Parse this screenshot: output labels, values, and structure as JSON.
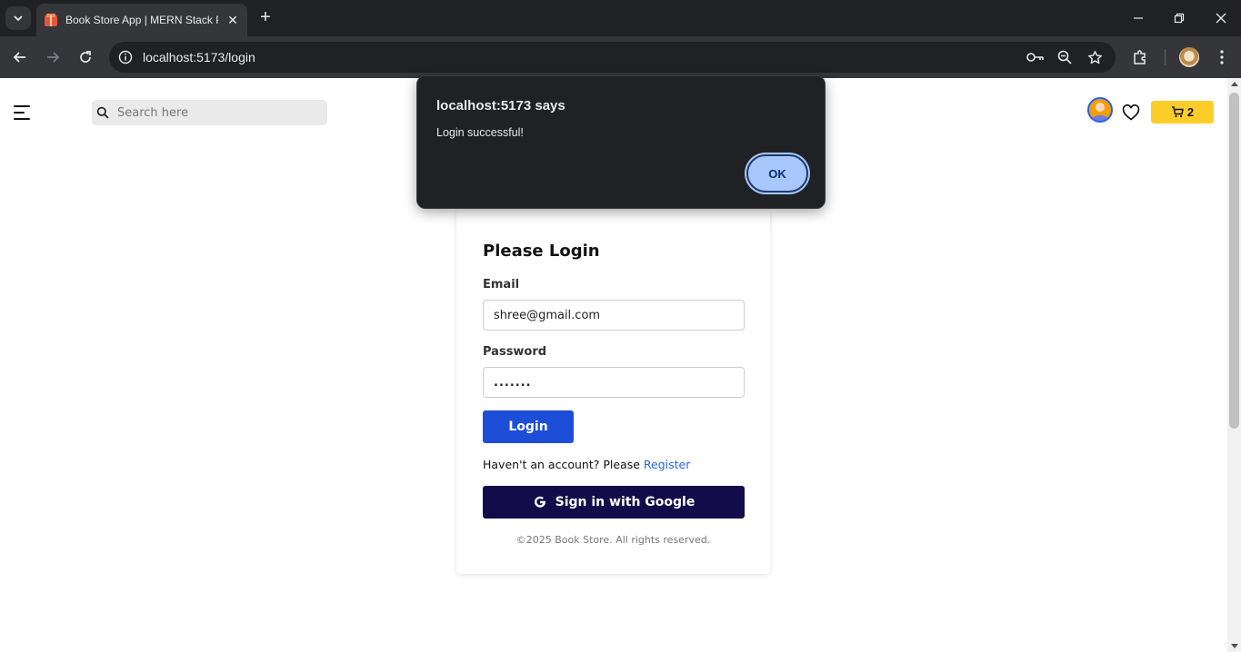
{
  "browser": {
    "tab_title": "Book Store App | MERN Stack P",
    "url": "localhost:5173/login"
  },
  "header": {
    "search_placeholder": "Search here",
    "cart_count": "2"
  },
  "login": {
    "title": "Please Login",
    "email_label": "Email",
    "email_value": "shree@gmail.com",
    "password_label": "Password",
    "password_value": ".......",
    "login_button": "Login",
    "register_prompt": "Haven't an account? Please ",
    "register_link": "Register",
    "google_button": "Sign in with Google",
    "footer": "©2025 Book Store. All rights reserved."
  },
  "dialog": {
    "title": "localhost:5173 says",
    "message": "Login successful!",
    "ok_button": "OK"
  },
  "colors": {
    "primary_blue": "#1d4ed8",
    "google_button_bg": "#120c4a",
    "cart_yellow": "#fccd29",
    "dialog_ok": "#a8c7fa"
  }
}
